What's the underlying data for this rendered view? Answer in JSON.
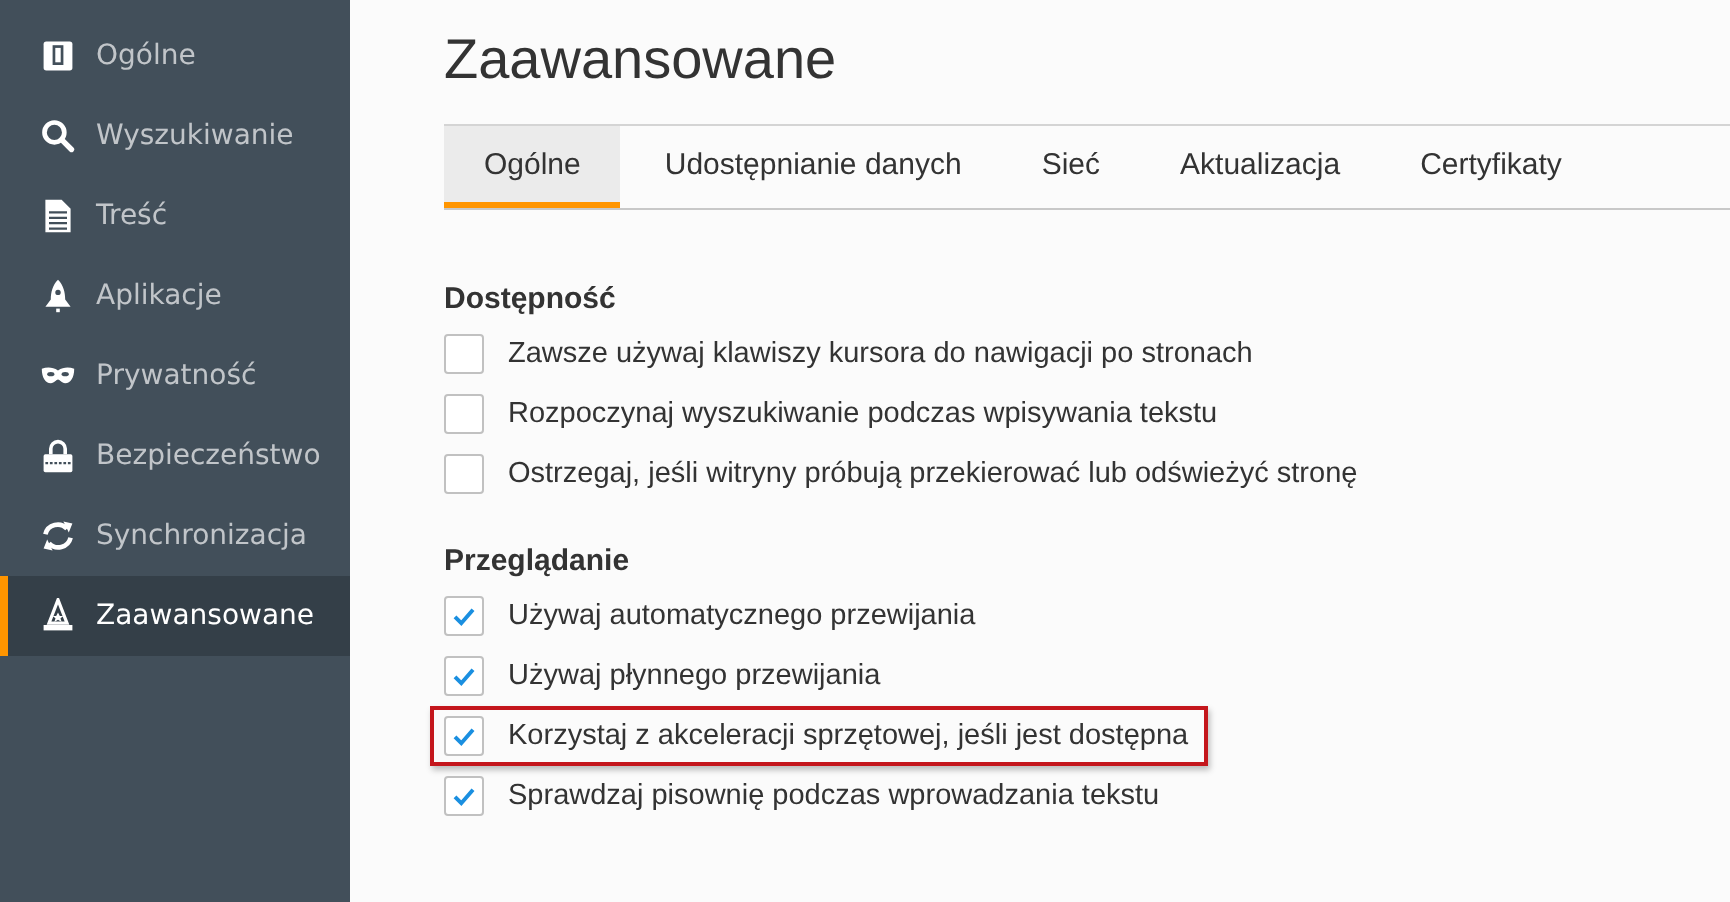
{
  "sidebar": {
    "items": [
      {
        "label": "Ogólne",
        "selected": false
      },
      {
        "label": "Wyszukiwanie",
        "selected": false
      },
      {
        "label": "Treść",
        "selected": false
      },
      {
        "label": "Aplikacje",
        "selected": false
      },
      {
        "label": "Prywatność",
        "selected": false
      },
      {
        "label": "Bezpieczeństwo",
        "selected": false
      },
      {
        "label": "Synchronizacja",
        "selected": false
      },
      {
        "label": "Zaawansowane",
        "selected": true
      }
    ]
  },
  "page_title": "Zaawansowane",
  "tabs": [
    {
      "label": "Ogólne",
      "selected": true
    },
    {
      "label": "Udostępnianie danych",
      "selected": false
    },
    {
      "label": "Sieć",
      "selected": false
    },
    {
      "label": "Aktualizacja",
      "selected": false
    },
    {
      "label": "Certyfikaty",
      "selected": false
    }
  ],
  "sections": [
    {
      "heading": "Dostępność",
      "options": [
        {
          "label": "Zawsze używaj klawiszy kursora do nawigacji po stronach",
          "checked": false,
          "highlighted": false
        },
        {
          "label": "Rozpoczynaj wyszukiwanie podczas wpisywania tekstu",
          "checked": false,
          "highlighted": false
        },
        {
          "label": "Ostrzegaj, jeśli witryny próbują przekierować lub odświeżyć stronę",
          "checked": false,
          "highlighted": false
        }
      ]
    },
    {
      "heading": "Przeglądanie",
      "options": [
        {
          "label": "Używaj automatycznego przewijania",
          "checked": true,
          "highlighted": false
        },
        {
          "label": "Używaj płynnego przewijania",
          "checked": true,
          "highlighted": false
        },
        {
          "label": "Korzystaj z akceleracji sprzętowej, jeśli jest dostępna",
          "checked": true,
          "highlighted": true
        },
        {
          "label": "Sprawdzaj pisownię podczas wprowadzania tekstu",
          "checked": true,
          "highlighted": false
        }
      ]
    }
  ]
}
